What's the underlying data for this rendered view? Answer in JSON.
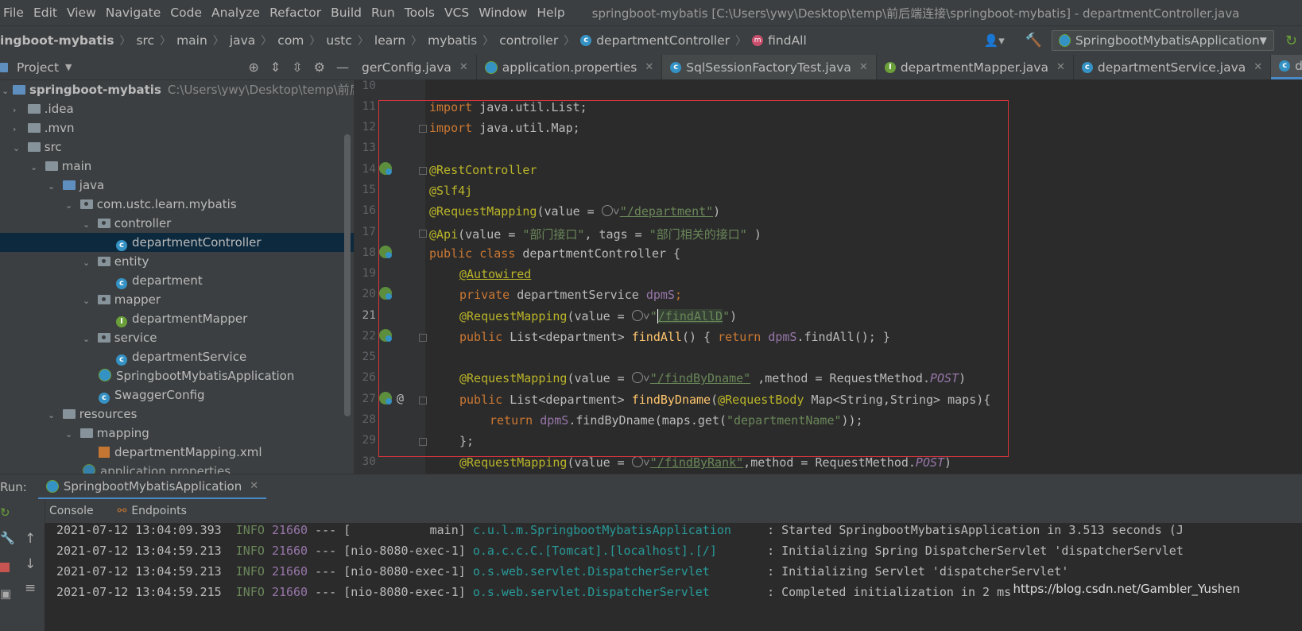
{
  "menu": {
    "items": [
      "File",
      "Edit",
      "View",
      "Navigate",
      "Code",
      "Analyze",
      "Refactor",
      "Build",
      "Run",
      "Tools",
      "VCS",
      "Window",
      "Help"
    ],
    "window_title": "springboot-mybatis [C:\\Users\\ywy\\Desktop\\temp\\前后端连接\\springboot-mybatis] - departmentController.java"
  },
  "breadcrumbs": {
    "items": [
      "ingboot-mybatis",
      "src",
      "main",
      "java",
      "com",
      "ustc",
      "learn",
      "mybatis",
      "controller",
      "departmentController",
      "findAll"
    ]
  },
  "run_config": {
    "label": "SpringbootMybatisApplication"
  },
  "project_panel": {
    "title": "Project",
    "project_name": "springboot-mybatis",
    "project_path": "C:\\Users\\ywy\\Desktop\\temp\\前后端连",
    "tree": [
      {
        "label": ".idea"
      },
      {
        "label": ".mvn"
      },
      {
        "label": "src"
      },
      {
        "label": "main"
      },
      {
        "label": "java"
      },
      {
        "label": "com.ustc.learn.mybatis"
      },
      {
        "label": "controller"
      },
      {
        "label": "departmentController"
      },
      {
        "label": "entity"
      },
      {
        "label": "department"
      },
      {
        "label": "mapper"
      },
      {
        "label": "departmentMapper"
      },
      {
        "label": "service"
      },
      {
        "label": "departmentService"
      },
      {
        "label": "SpringbootMybatisApplication"
      },
      {
        "label": "SwaggerConfig"
      },
      {
        "label": "resources"
      },
      {
        "label": "mapping"
      },
      {
        "label": "departmentMapping.xml"
      },
      {
        "label": "application.properties"
      }
    ]
  },
  "tabs": [
    {
      "label": "gerConfig.java"
    },
    {
      "label": "application.properties"
    },
    {
      "label": "SqlSessionFactoryTest.java"
    },
    {
      "label": "departmentMapper.java"
    },
    {
      "label": "departmentService.java"
    },
    {
      "label": "depar"
    }
  ],
  "editor": {
    "line_numbers": [
      "10",
      "11",
      "12",
      "13",
      "14",
      "15",
      "16",
      "17",
      "18",
      "19",
      "20",
      "21",
      "22",
      "25",
      "26",
      "27",
      "28",
      "29",
      "30"
    ],
    "code": {
      "l11_kw": "import",
      "l11_rest": " java.util.List;",
      "l12_kw": "import",
      "l12_rest": " java.util.Map;",
      "l14": "@RestController",
      "l15": "@Slf4j",
      "l16_ann": "@RequestMapping",
      "l16_a": "(value = ",
      "l16_str": "\"/department\"",
      "l16_b": ")",
      "l17_ann": "@Api",
      "l17_a": "(value = ",
      "l17_s1": "\"部门接口\"",
      "l17_b": ", tags = ",
      "l17_s2": "\"部门相关的接口\"",
      "l17_c": " )",
      "l18_kw": "public class",
      "l18_rest": " departmentController {",
      "l19": "@Autowired",
      "l20_kw": "private",
      "l20_mid": " departmentService ",
      "l20_fld": "dpmS",
      "l20_end": ";",
      "l21_ann": "@RequestMapping",
      "l21_a": "(value = ",
      "l21_q": "\"",
      "l21_str": "/findAllD",
      "l21_q2": "\"",
      "l21_b": ")",
      "l22_kw": "public",
      "l22_a": " List<department> ",
      "l22_fn": "findAll",
      "l22_b": "() { ",
      "l22_kw2": "return",
      "l22_fld": " dpmS",
      "l22_c": ".findAll(); }",
      "l26_ann": "@RequestMapping",
      "l26_a": "(value = ",
      "l26_str": "\"/findByDname\"",
      "l26_b": " ,method = RequestMethod.",
      "l26_it": "POST",
      "l26_c": ")",
      "l27_kw": "public",
      "l27_a": " List<department> ",
      "l27_fn": "findByDname",
      "l27_b": "(",
      "l27_ann": "@RequestBody",
      "l27_c": " Map<String,String> maps){",
      "l28_kw": "return",
      "l28_fld": " dpmS",
      "l28_a": ".findByDname(maps.get(",
      "l28_str": "\"departmentName\"",
      "l28_b": "));",
      "l29": "};",
      "l30_ann": "@RequestMapping",
      "l30_a": "(value = ",
      "l30_str": "\"/findByRank\"",
      "l30_b": ",method = RequestMethod.",
      "l30_it": "POST",
      "l30_c": ")"
    }
  },
  "run_panel": {
    "label": "Run:",
    "tab": "SpringbootMybatisApplication",
    "tools": [
      "Console",
      "Endpoints"
    ],
    "log": [
      {
        "ts": "2021-07-12 13:04:09.393",
        "level": "INFO",
        "pid": "21660",
        "sep": " --- ",
        "thread": "[           main]",
        "logger": "c.u.l.m.SpringbootMybatisApplication    ",
        "msg": ": Started SpringbootMybatisApplication in 3.513 seconds (J"
      },
      {
        "ts": "2021-07-12 13:04:59.213",
        "level": "INFO",
        "pid": "21660",
        "sep": " --- ",
        "thread": "[nio-8080-exec-1]",
        "logger": "o.a.c.c.C.[Tomcat].[localhost].[/]      ",
        "msg": ": Initializing Spring DispatcherServlet 'dispatcherServlet"
      },
      {
        "ts": "2021-07-12 13:04:59.213",
        "level": "INFO",
        "pid": "21660",
        "sep": " --- ",
        "thread": "[nio-8080-exec-1]",
        "logger": "o.s.web.servlet.DispatcherServlet       ",
        "msg": ": Initializing Servlet 'dispatcherServlet'"
      },
      {
        "ts": "2021-07-12 13:04:59.215",
        "level": "INFO",
        "pid": "21660",
        "sep": " --- ",
        "thread": "[nio-8080-exec-1]",
        "logger": "o.s.web.servlet.DispatcherServlet       ",
        "msg": ": Completed initialization in 2 ms"
      }
    ]
  },
  "watermark": "https://blog.csdn.net/Gambler_Yushen"
}
